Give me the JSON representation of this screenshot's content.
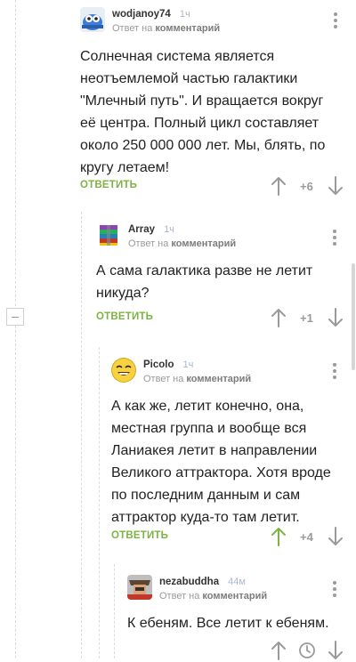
{
  "ui": {
    "reply_label": "ОТВЕТИТЬ",
    "reply_to_prefix": "Ответ на",
    "reply_to_target": "комментарий"
  },
  "comments": [
    {
      "author": "wodjanoy74",
      "time": "1ч",
      "text": "Солнечная система является неотъемлемой частью галактики \"Млечный путь\". И вращается вокруг её центра. Полный цикл составляет около 250 000 000 лет. Мы, блять, по кругу летаем!",
      "rating": "+6"
    },
    {
      "author": "Array",
      "time": "1ч",
      "text": "А сама галактика разве не летит никуда?",
      "rating": "+1"
    },
    {
      "author": "Picolo",
      "time": "1ч",
      "text": "А как же, летит конечно, она, местная группа и вообще вся Ланиакея летит в направлении Великого аттрактора. Хотя вроде по последним данным и сам аттрактор куда-то там летит.",
      "rating": "+4"
    },
    {
      "author": "nezabuddha",
      "time": "44м",
      "text": "К ебеням. Все летит к ебеням.",
      "rating": ""
    }
  ],
  "colors": {
    "reply_green": "#7cb342",
    "upvote_active": "#7cb342",
    "neutral_gray": "#9a9a9a",
    "time_blue": "#a7b8cf"
  },
  "icons": [
    "avatar-wodjanoy74",
    "avatar-array",
    "avatar-picolo",
    "avatar-nezabuddha",
    "more-vert-icon",
    "upvote-arrow-icon",
    "downvote-arrow-icon",
    "clock-icon",
    "collapse-thread-icon"
  ]
}
